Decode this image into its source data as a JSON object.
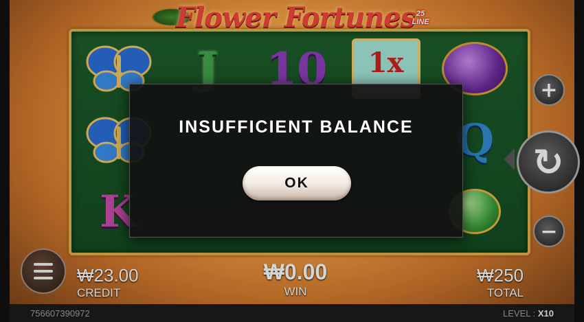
{
  "game": {
    "title": "Flower Fortunes",
    "lines_badge": "25 LINE"
  },
  "reels": {
    "row1": [
      "butterfly",
      "J",
      "10",
      "1x",
      "purple-purse"
    ],
    "row2": [
      "butterfly",
      "",
      "",
      "",
      "Q"
    ],
    "row3": [
      "K",
      "",
      "",
      "",
      "jade-ornament"
    ],
    "multiplier_label": "1x",
    "sym_J": "J",
    "sym_10": "10",
    "sym_Q": "Q",
    "sym_K": "K"
  },
  "stats": {
    "credit_value": "₩23.00",
    "credit_label": "CREDIT",
    "win_value": "₩0.00",
    "win_label": "WIN",
    "total_value": "₩250",
    "total_label": "TOTAL"
  },
  "footer": {
    "session_id": "756607390972",
    "level_label": "LEVEL :",
    "level_value": "X10"
  },
  "controls": {
    "plus_glyph": "+",
    "minus_glyph": "−",
    "spin_glyph": "↻"
  },
  "modal": {
    "message": "INSUFFICIENT BALANCE",
    "ok_label": "OK"
  },
  "colors": {
    "reel_bg": "#1d5a2a",
    "frame_gold": "#d9a94a",
    "modal_bg": "#121212",
    "title_red": "#e9453a"
  }
}
